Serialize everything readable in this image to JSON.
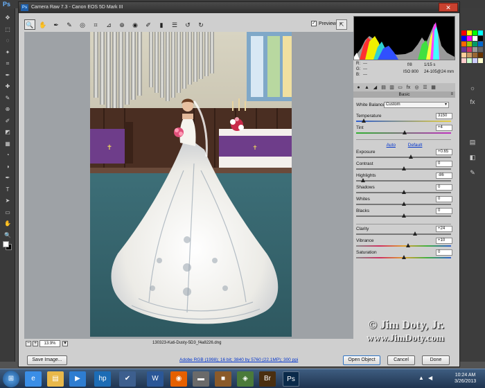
{
  "photoshop": {
    "logo": "Ps",
    "tool_icons": [
      "move-icon",
      "marquee-icon",
      "lasso-icon",
      "quick-select-icon",
      "crop-icon",
      "eyedropper-icon",
      "healing-icon",
      "brush-icon",
      "clone-stamp-icon",
      "history-brush-icon",
      "eraser-icon",
      "gradient-icon",
      "blur-icon",
      "dodge-icon",
      "pen-icon",
      "type-icon",
      "path-select-icon",
      "shape-icon",
      "hand-icon",
      "zoom-icon"
    ],
    "swatch_colors": [
      "#ff0000",
      "#ffff00",
      "#00ff00",
      "#00ffff",
      "#0000ff",
      "#ff00ff",
      "#ffffff",
      "#000000",
      "#ff6600",
      "#99cc00",
      "#009966",
      "#0066cc",
      "#663399",
      "#cc3366",
      "#999999",
      "#666666",
      "#ffcc99",
      "#cc9966",
      "#996633",
      "#663300",
      "#ffcccc",
      "#ccffcc",
      "#ccccff",
      "#ffffcc"
    ]
  },
  "dialog": {
    "title": "Camera Raw 7.3  -  Canon EOS 5D Mark III",
    "close_glyph": "✕",
    "app_icon": "Ps"
  },
  "toolbar": {
    "tools": [
      {
        "name": "zoom-tool",
        "glyph": "🔍",
        "active": true
      },
      {
        "name": "hand-tool",
        "glyph": "✋"
      },
      {
        "name": "white-balance-tool",
        "glyph": "✒"
      },
      {
        "name": "color-sampler-tool",
        "glyph": "✎"
      },
      {
        "name": "targeted-adjustment-tool",
        "glyph": "◎"
      },
      {
        "name": "crop-tool",
        "glyph": "⌗"
      },
      {
        "name": "straighten-tool",
        "glyph": "⊿"
      },
      {
        "name": "spot-removal-tool",
        "glyph": "⊕"
      },
      {
        "name": "red-eye-tool",
        "glyph": "◉"
      },
      {
        "name": "adjustment-brush-tool",
        "glyph": "✐"
      },
      {
        "name": "graduated-filter-tool",
        "glyph": "▮"
      },
      {
        "name": "preferences-tool",
        "glyph": "☰"
      },
      {
        "name": "rotate-ccw-tool",
        "glyph": "↺"
      },
      {
        "name": "rotate-cw-tool",
        "glyph": "↻"
      }
    ],
    "preview_label": "Preview",
    "preview_checked": "✓",
    "fullscreen_glyph": "⇱"
  },
  "canvas": {
    "zoom_value": "13.9%",
    "zoom_minus": "−",
    "zoom_plus": "+",
    "zoom_menu": "▾",
    "filename": "130323-Kati-Dusty-5D3_f4a8226.dng",
    "watermark_line1": "© Jim Doty, Jr.",
    "watermark_line2": "www.JimDoty.com"
  },
  "histogram": {
    "r_label": "R:",
    "r_value": "---",
    "g_label": "G:",
    "g_value": "---",
    "b_label": "B:",
    "b_value": "---",
    "aperture": "f/8",
    "shutter": "1/15 s",
    "iso": "ISO 800",
    "lens": "24-105@24 mm"
  },
  "panel": {
    "tab_icons": [
      "basic-tab-icon",
      "tone-curve-tab-icon",
      "detail-tab-icon",
      "hsl-tab-icon",
      "split-toning-tab-icon",
      "lens-corrections-tab-icon",
      "effects-tab-icon",
      "camera-calibration-tab-icon",
      "presets-tab-icon",
      "snapshots-tab-icon"
    ],
    "tab_glyphs": [
      "●",
      "▲",
      "◢",
      "▤",
      "▥",
      "▭",
      "fx",
      "◎",
      "☰",
      "▦"
    ],
    "title": "Basic",
    "menu_glyph": "≡",
    "white_balance_label": "White Balance:",
    "white_balance_value": "Custom",
    "auto_label": "Auto",
    "default_label": "Default",
    "sliders": {
      "temperature": {
        "label": "Temperature",
        "value": "3150",
        "position": 0.08
      },
      "tint": {
        "label": "Tint",
        "value": "+4",
        "position": 0.51
      },
      "exposure": {
        "label": "Exposure",
        "value": "+0.65",
        "position": 0.58
      },
      "contrast": {
        "label": "Contrast",
        "value": "0",
        "position": 0.5
      },
      "highlights": {
        "label": "Highlights",
        "value": "-86",
        "position": 0.07
      },
      "shadows": {
        "label": "Shadows",
        "value": "0",
        "position": 0.5
      },
      "whites": {
        "label": "Whites",
        "value": "0",
        "position": 0.5
      },
      "blacks": {
        "label": "Blacks",
        "value": "0",
        "position": 0.5
      },
      "clarity": {
        "label": "Clarity",
        "value": "+24",
        "position": 0.62
      },
      "vibrance": {
        "label": "Vibrance",
        "value": "+10",
        "position": 0.55
      },
      "saturation": {
        "label": "Saturation",
        "value": "0",
        "position": 0.5
      }
    }
  },
  "bottom": {
    "save_label": "Save Image...",
    "workflow_label": "Adobe RGB (1998); 16 bit; 3840 by 5760 (22.1MP); 300 ppi",
    "open_label": "Open Object",
    "cancel_label": "Cancel",
    "done_label": "Done"
  },
  "taskbar": {
    "start_glyph": "⊞",
    "apps": [
      {
        "name": "taskbar-ie-icon",
        "glyph": "e",
        "color": "#3a8ee6"
      },
      {
        "name": "taskbar-explorer-icon",
        "glyph": "▤",
        "color": "#e8b84a"
      },
      {
        "name": "taskbar-media-player-icon",
        "glyph": "▶",
        "color": "#2e7dd1"
      },
      {
        "name": "taskbar-hp-icon",
        "glyph": "hp",
        "color": "#1c6cb5"
      },
      {
        "name": "taskbar-checkmark-icon",
        "glyph": "✔",
        "color": "#3d5f8e"
      },
      {
        "name": "taskbar-word-icon",
        "glyph": "W",
        "color": "#2b5797"
      },
      {
        "name": "taskbar-firefox-icon",
        "glyph": "◉",
        "color": "#e66000"
      },
      {
        "name": "taskbar-drive-icon",
        "glyph": "▬",
        "color": "#6a6a6a"
      },
      {
        "name": "taskbar-briefcase-icon",
        "glyph": "■",
        "color": "#8a5a2a"
      },
      {
        "name": "taskbar-network-icon",
        "glyph": "◈",
        "color": "#4a7a3a"
      },
      {
        "name": "taskbar-bridge-icon",
        "glyph": "Br",
        "color": "#4a2f10"
      },
      {
        "name": "taskbar-photoshop-icon",
        "glyph": "Ps",
        "color": "#0a2a4a"
      }
    ],
    "time": "10:24 AM",
    "date": "3/26/2013",
    "tray_up": "▲",
    "tray_speaker": "◀"
  }
}
